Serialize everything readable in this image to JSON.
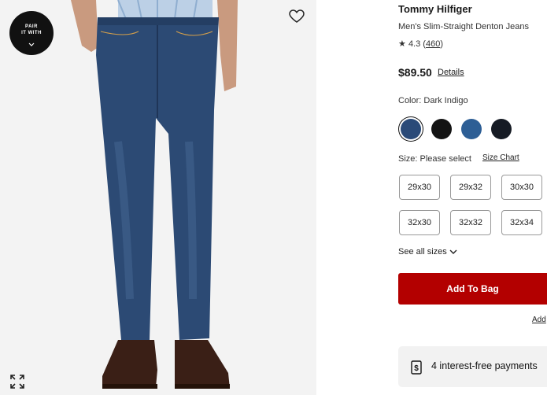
{
  "product": {
    "brand": "Tommy Hilfiger",
    "name": "Men's Slim-Straight Denton Jeans",
    "rating": "4.3",
    "review_count": "460",
    "price": "$89.50",
    "details_label": "Details"
  },
  "image": {
    "pair_badge_line1": "PAIR",
    "pair_badge_line2": "IT WITH"
  },
  "color": {
    "label": "Color: Dark Indigo",
    "swatches": [
      {
        "name": "Dark Indigo",
        "hex": "#2a4a78",
        "selected": true
      },
      {
        "name": "Black",
        "hex": "#141414",
        "selected": false
      },
      {
        "name": "Blue",
        "hex": "#2d5e95",
        "selected": false
      },
      {
        "name": "Navy Black",
        "hex": "#161b24",
        "selected": false
      }
    ]
  },
  "size": {
    "label": "Size: Please select",
    "chart_label": "Size Chart",
    "options": [
      "29x30",
      "29x32",
      "30x30",
      "32x30",
      "32x32",
      "32x34"
    ],
    "see_all_label": "See all sizes"
  },
  "actions": {
    "add_to_bag": "Add To Bag",
    "add_link": "Add"
  },
  "installments": {
    "text": "4 interest-free payments"
  },
  "colors": {
    "accent_red": "#b30000",
    "denim": "#2c4a74"
  }
}
